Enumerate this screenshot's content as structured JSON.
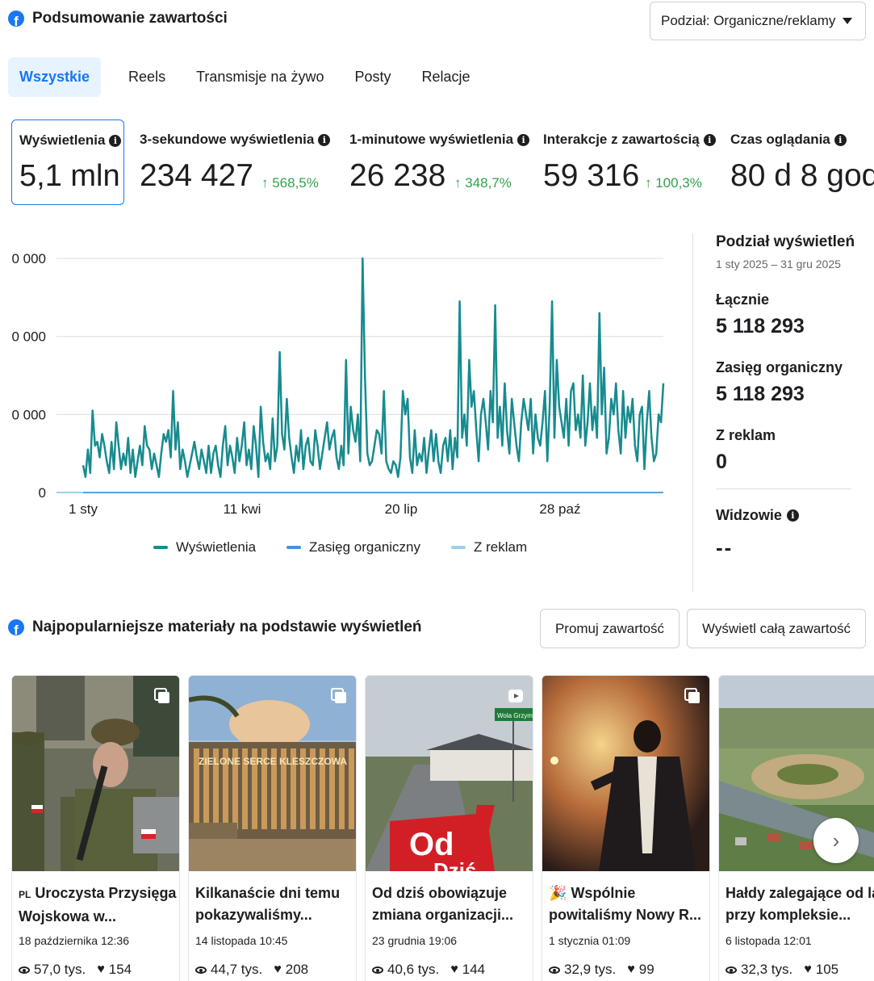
{
  "header": {
    "title": "Podsumowanie zawartości",
    "split_dropdown": "Podział: Organiczne/reklamy"
  },
  "tabs": [
    "Wszystkie",
    "Reels",
    "Transmisje na żywo",
    "Posty",
    "Relacje"
  ],
  "active_tab": "Wszystkie",
  "metrics": [
    {
      "label": "Wyświetlenia",
      "value": "5,1 mln",
      "change": ""
    },
    {
      "label": "3-sekundowe wyświetlenia",
      "value": "234 427",
      "change": "↑ 568,5%"
    },
    {
      "label": "1-minutowe wyświetlenia",
      "value": "26 238",
      "change": "↑ 348,7%"
    },
    {
      "label": "Interakcje z zawartością",
      "value": "59 316",
      "change": "↑ 100,3%"
    },
    {
      "label": "Czas oglądania",
      "value": "80 d 8 god",
      "change": ""
    }
  ],
  "chart_data": {
    "type": "line",
    "y_tick_labels": [
      "0 000",
      "0 000",
      "0 000",
      "0"
    ],
    "x_tick_labels": [
      "1 sty",
      "11 kwi",
      "20 lip",
      "28 paź"
    ],
    "ylim": [
      0,
      30
    ],
    "grid": true,
    "legend_position": "bottom",
    "series": [
      {
        "name": "Wyświetlenia",
        "color": "#178b8f",
        "values": [
          3.5,
          2,
          5.5,
          2.5,
          10.5,
          6,
          6.5,
          4.5,
          7.5,
          6,
          4,
          2.5,
          6.5,
          3,
          9,
          6,
          3,
          5,
          3.5,
          7,
          2.5,
          5.5,
          2,
          4,
          6,
          3.5,
          8.5,
          6,
          5.5,
          3,
          5,
          3.5,
          2,
          5,
          7.5,
          6.5,
          8,
          4.5,
          13,
          5.5,
          9,
          3,
          5.5,
          4,
          2,
          3.5,
          5,
          6.5,
          4.5,
          3,
          5.5,
          4,
          2.5,
          6,
          2.5,
          5,
          6,
          3.5,
          2,
          6,
          8.5,
          3.5,
          6,
          4.5,
          2.5,
          7,
          4,
          6,
          9,
          3.5,
          5.5,
          3,
          8.5,
          6,
          2,
          11,
          6.5,
          4,
          5,
          3,
          9.5,
          4,
          6,
          18,
          7.5,
          5.5,
          12,
          7,
          4.5,
          2.5,
          6,
          4,
          8,
          3,
          6,
          7,
          4,
          3.5,
          8,
          6,
          3,
          5,
          7,
          9,
          5.5,
          7,
          8,
          4.5,
          3,
          6,
          3.5,
          17,
          5,
          11,
          8,
          6.5,
          10,
          4,
          30,
          15,
          5,
          3.5,
          4,
          6,
          8,
          7.5,
          5,
          13,
          4,
          3,
          2.5,
          4,
          3.5,
          2,
          4.5,
          13,
          10,
          12,
          4.5,
          2.5,
          8,
          3.5,
          5,
          4,
          7,
          2.5,
          5.5,
          8,
          4,
          7.5,
          4,
          2.5,
          6,
          7,
          4,
          8,
          3,
          7,
          4.5,
          24.5,
          7,
          10,
          6,
          17,
          11,
          13,
          8,
          4,
          10,
          12,
          9,
          5.5,
          13,
          9,
          24,
          7,
          11,
          6,
          14,
          8,
          5,
          12,
          9,
          6,
          4,
          9,
          12,
          10,
          8,
          12,
          5,
          10,
          7,
          6,
          9,
          13,
          4,
          11,
          24.5,
          7,
          17,
          11,
          9,
          7,
          12,
          6,
          13,
          14,
          8,
          10,
          7,
          15,
          6,
          9,
          14,
          8,
          11,
          7,
          23,
          10,
          16,
          5,
          7,
          12,
          10,
          14,
          8,
          5,
          13,
          7,
          11,
          9,
          12,
          6,
          4,
          10,
          11,
          3,
          9,
          13,
          7,
          4,
          5,
          10,
          9,
          14
        ],
        "note": ""
      },
      {
        "name": "Zasięg organiczny",
        "color": "#4a90d9",
        "values": []
      },
      {
        "name": "Z reklam",
        "color": "#9bd2ec",
        "values": []
      }
    ]
  },
  "side_panel": {
    "title": "Podział wyświetleń",
    "range": "1 sty 2025 – 31 gru 2025",
    "total_label": "Łącznie",
    "total_value": "5 118 293",
    "organic_label": "Zasięg organiczny",
    "organic_value": "5 118 293",
    "ads_label": "Z reklam",
    "ads_value": "0",
    "viewers_label": "Widzowie",
    "viewers_value": "--"
  },
  "top_content": {
    "title": "Najpopularniejsze materiały na podstawie wyświetleń",
    "promote_button": "Promuj zawartość",
    "view_all_button": "Wyświetl całą zawartość",
    "cards": [
      {
        "title": "🇵🇱 Uroczysta Przysięga Wojskowa w...",
        "flag_prefix": "PL",
        "title_text": "Uroczysta Przysięga Wojskowa w...",
        "date": "18 października 12:36",
        "views": "57,0 tys.",
        "likes": "154",
        "type_icon": "album-icon"
      },
      {
        "title": "Kilkanaście dni temu pokazywaliśmy...",
        "flag_prefix": "",
        "title_text": "Kilkanaście dni temu pokazywaliśmy...",
        "date": "14 listopada 10:45",
        "views": "44,7 tys.",
        "likes": "208",
        "type_icon": "album-icon",
        "thumb_text": "ZIELONE SERCE KLESZCZOWA"
      },
      {
        "title": "Od dziś obowiązuje zmiana organizacji...",
        "flag_prefix": "",
        "title_text": "Od dziś obowiązuje zmiana organizacji...",
        "date": "23 grudnia 19:06",
        "views": "40,6 tys.",
        "likes": "144",
        "type_icon": "reel-icon",
        "thumb_text": "Od",
        "thumb_text2": "Dziś",
        "sign_text": "Wola Grzym"
      },
      {
        "title": "🎉 Wspólnie powitaliśmy Nowy R...",
        "flag_prefix": "🎉",
        "title_text": "Wspólnie powitaliśmy Nowy R...",
        "date": "1 stycznia 01:09",
        "views": "32,9 tys.",
        "likes": "99",
        "type_icon": "album-icon"
      },
      {
        "title": "Hałdy zalegające od la przy kompleksie...",
        "flag_prefix": "",
        "title_text": "Hałdy zalegające od la przy kompleksie...",
        "date": "6 listopada 12:01",
        "views": "32,3 tys.",
        "likes": "105",
        "type_icon": "album-icon"
      }
    ]
  },
  "colors": {
    "accent": "#1877f2",
    "positive": "#31a24c",
    "series_views": "#178b8f",
    "series_organic": "#4a90d9",
    "series_ads": "#9bd2ec"
  }
}
